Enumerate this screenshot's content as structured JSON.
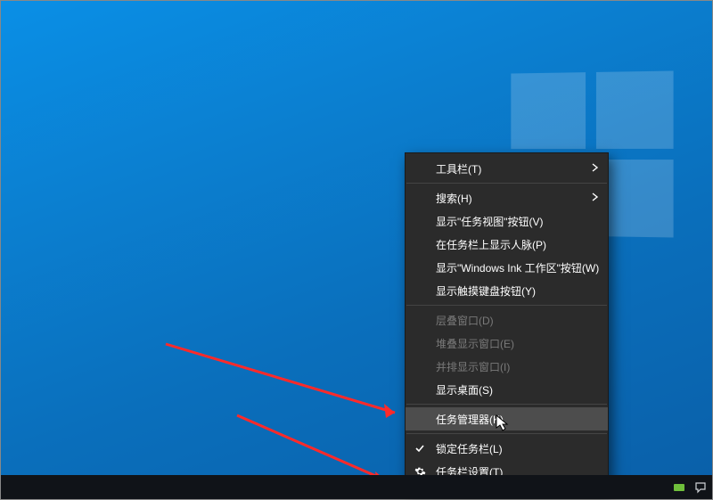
{
  "menu": {
    "toolbars": "工具栏(T)",
    "search": "搜索(H)",
    "show_taskview_btn": "显示\"任务视图\"按钮(V)",
    "show_people": "在任务栏上显示人脉(P)",
    "show_ink": "显示\"Windows Ink 工作区\"按钮(W)",
    "show_touchkb": "显示触摸键盘按钮(Y)",
    "cascade": "层叠窗口(D)",
    "stacked": "堆叠显示窗口(E)",
    "sidebyside": "并排显示窗口(I)",
    "show_desktop": "显示桌面(S)",
    "task_manager": "任务管理器(K)",
    "lock_taskbar": "锁定任务栏(L)",
    "taskbar_settings": "任务栏设置(T)"
  }
}
